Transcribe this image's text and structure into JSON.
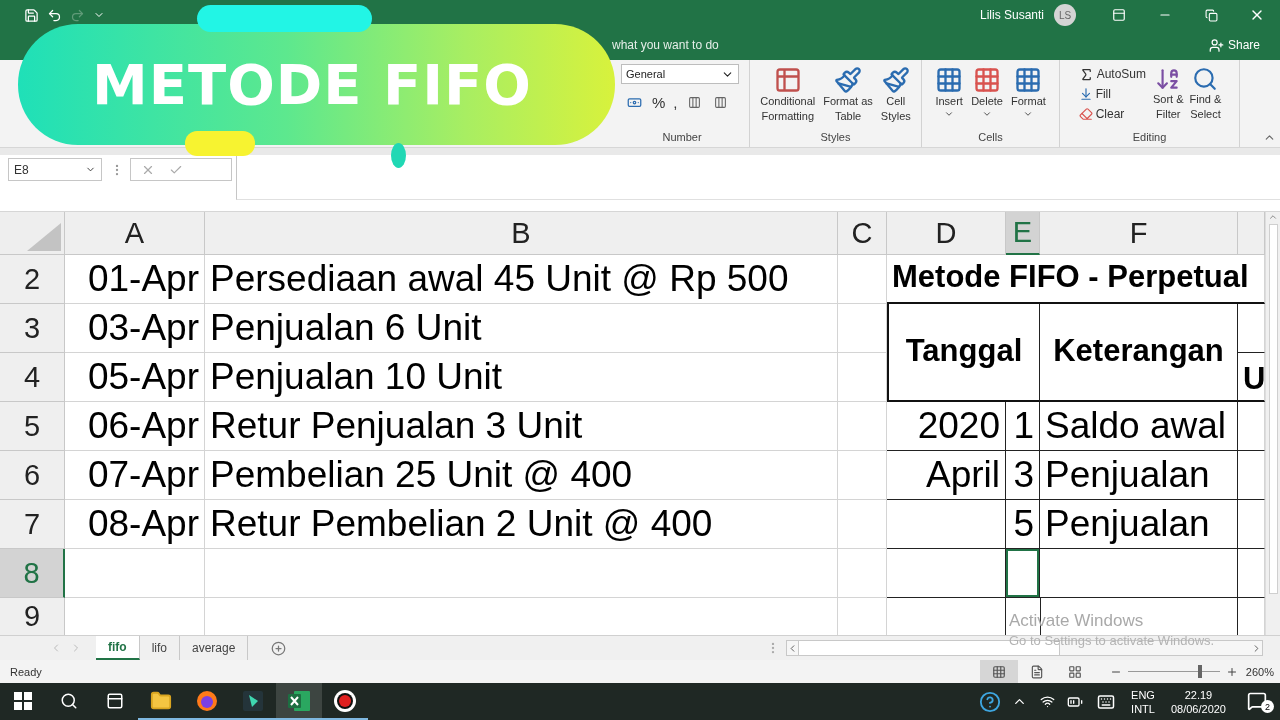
{
  "quick_access": [
    {
      "kind": "save",
      "disabled": false
    },
    {
      "kind": "undo",
      "disabled": false
    },
    {
      "kind": "redo",
      "disabled": true
    },
    {
      "kind": "customize",
      "disabled": false
    }
  ],
  "title_bar": {
    "user_name": "Lilis Susanti",
    "avatar_initials": "LS"
  },
  "tell_me": {
    "text": "what you want to do"
  },
  "share": {
    "label": "Share"
  },
  "banner": {
    "title": "METODE FIFO"
  },
  "ribbon": {
    "number": {
      "label": "Number",
      "format": "General",
      "symbols": [
        "%",
        ","
      ]
    },
    "styles": {
      "label": "Styles",
      "buttons": [
        {
          "lines": [
            "Conditional",
            "Formatting"
          ]
        },
        {
          "lines": [
            "Format as",
            "Table"
          ]
        },
        {
          "lines": [
            "Cell",
            "Styles"
          ]
        }
      ]
    },
    "cells": {
      "label": "Cells",
      "buttons": [
        "Insert",
        "Delete",
        "Format"
      ]
    },
    "editing": {
      "label": "Editing",
      "small": [
        {
          "kind": "autosum",
          "label": "AutoSum"
        },
        {
          "kind": "fill",
          "label": "Fill"
        },
        {
          "kind": "clear",
          "label": "Clear"
        }
      ],
      "large": [
        {
          "kind": "sort",
          "lines": [
            "Sort &",
            "Filter"
          ]
        },
        {
          "kind": "find",
          "lines": [
            "Find &",
            "Select"
          ]
        }
      ]
    }
  },
  "formula_bar": {
    "name_box": "E8"
  },
  "columns": [
    {
      "label": "A",
      "selected": false
    },
    {
      "label": "B",
      "selected": false
    },
    {
      "label": "C",
      "selected": false
    },
    {
      "label": "D",
      "selected": false
    },
    {
      "label": "E",
      "selected": true
    },
    {
      "label": "F",
      "selected": false
    }
  ],
  "rows": [
    {
      "label": "2",
      "selected": false,
      "a": "01-Apr",
      "b": "Persediaan awal 45 Unit @ Rp 500"
    },
    {
      "label": "3",
      "selected": false,
      "a": "03-Apr",
      "b": "Penjualan 6 Unit"
    },
    {
      "label": "4",
      "selected": false,
      "a": "05-Apr",
      "b": "Penjualan 10 Unit"
    },
    {
      "label": "5",
      "selected": false,
      "a": "06-Apr",
      "b": "Retur Penjualan 3 Unit"
    },
    {
      "label": "6",
      "selected": false,
      "a": "07-Apr",
      "b": "Pembelian 25 Unit @ 400"
    },
    {
      "label": "7",
      "selected": false,
      "a": "08-Apr",
      "b": "Retur Pembelian 2 Unit @ 400"
    },
    {
      "label": "8",
      "selected": true
    },
    {
      "label": "9",
      "selected": false
    }
  ],
  "fifo_table": {
    "title": "Metode FIFO - Perpetual",
    "headers": [
      "Tanggal",
      "Keterangan"
    ],
    "partial_header": "U",
    "entries": [
      {
        "period": "2020",
        "day": "1",
        "description": "Saldo awal"
      },
      {
        "period": "April",
        "day": "3",
        "description": "Penjualan"
      },
      {
        "day": "5",
        "description": "Penjualan"
      }
    ]
  },
  "sheet_tabs": [
    {
      "label": "fifo",
      "selected": true
    },
    {
      "label": "lifo",
      "selected": false
    },
    {
      "label": "average",
      "selected": false
    }
  ],
  "status": {
    "text": "Ready",
    "views": [
      {
        "kind": "normal",
        "selected": true
      },
      {
        "kind": "page_layout",
        "selected": false
      },
      {
        "kind": "page_break",
        "selected": false
      }
    ],
    "zoom": {
      "level": 0.76,
      "reading": "260%"
    }
  },
  "activation_notice": {
    "title": "Activate Windows",
    "text": "Go to Settings to activate Windows."
  },
  "taskbar": {
    "apps": [
      {
        "kind": "explorer",
        "active": false,
        "running": true
      },
      {
        "kind": "firefox",
        "active": false,
        "running": true
      },
      {
        "kind": "editor",
        "active": false,
        "running": true
      },
      {
        "kind": "excel",
        "active": true,
        "running": true
      },
      {
        "kind": "recorder",
        "active": false,
        "running": true
      }
    ],
    "language": [
      "ENG",
      "INTL"
    ],
    "time": "22.19",
    "date": "08/06/2020",
    "notifications": "2"
  }
}
